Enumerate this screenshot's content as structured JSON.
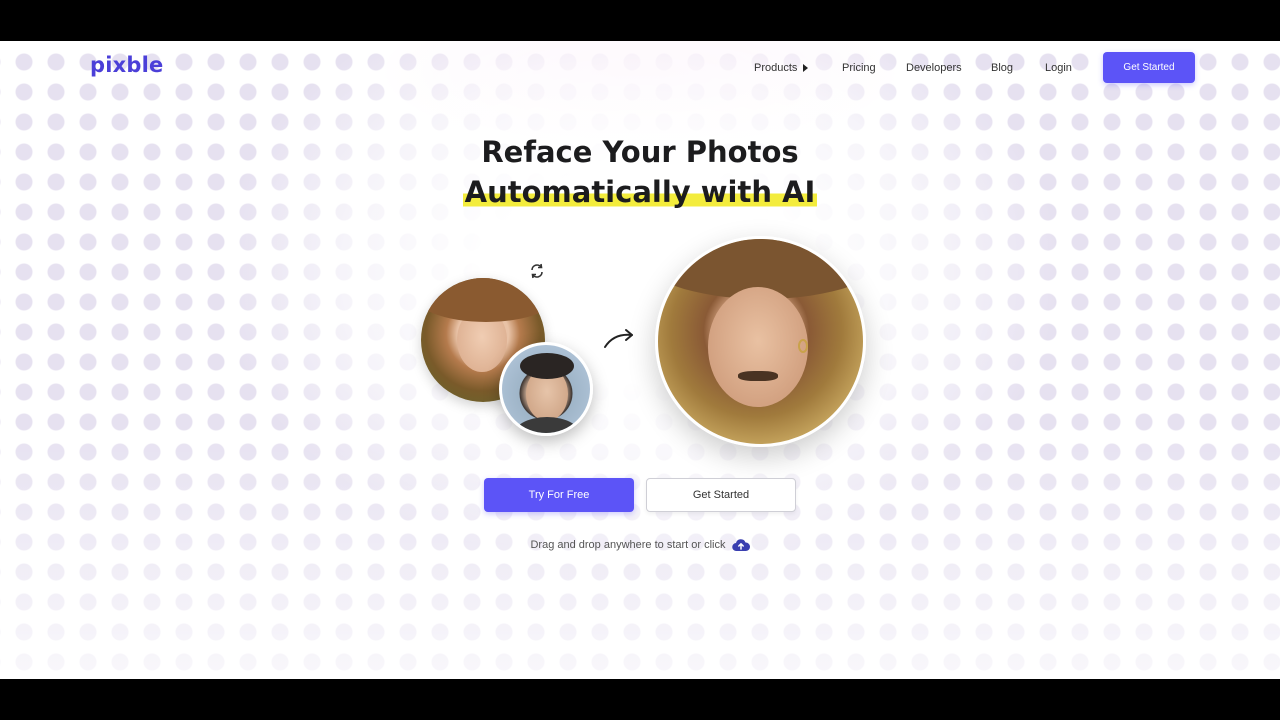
{
  "brand": {
    "logo_text": "pixble",
    "accent_color": "#5c54f7"
  },
  "nav": {
    "items": [
      {
        "label": "Products",
        "has_caret": true
      },
      {
        "label": "Pricing"
      },
      {
        "label": "Developers"
      },
      {
        "label": "Blog"
      },
      {
        "label": "Login"
      }
    ],
    "cta_label": "Get Started"
  },
  "hero": {
    "title_line1": "Reface Your Photos",
    "title_line2": "Automatically with AI",
    "highlight_color": "#f3ec3d"
  },
  "actions": {
    "primary_label": "Try For Free",
    "secondary_label": "Get Started"
  },
  "dropzone": {
    "text": "Drag and drop anywhere to start or click",
    "icon": "cloud-upload-icon"
  }
}
